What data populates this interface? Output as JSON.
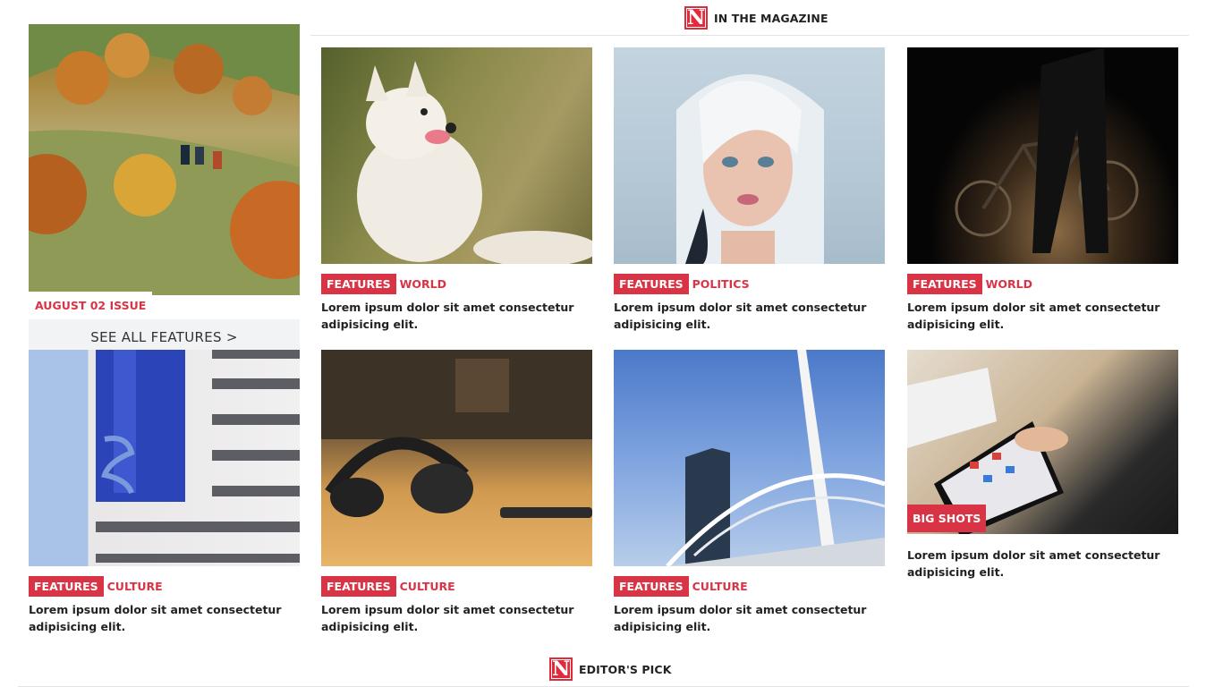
{
  "magazine_section": {
    "title": "IN THE MAGAZINE",
    "logo_letter": "N"
  },
  "editors_section": {
    "title": "EDITOR'S PICK",
    "logo_letter": "N"
  },
  "feature": {
    "issue_label": "AUGUST 02 ISSUE",
    "see_all_label": "SEE ALL FEATURES >"
  },
  "cards": [
    {
      "tag": "FEATURES",
      "category": "WORLD",
      "excerpt": "Lorem ipsum dolor sit amet consectetur adipisicing elit."
    },
    {
      "tag": "FEATURES",
      "category": "POLITICS",
      "excerpt": "Lorem ipsum dolor sit amet consectetur adipisicing elit."
    },
    {
      "tag": "FEATURES",
      "category": "WORLD",
      "excerpt": "Lorem ipsum dolor sit amet consectetur adipisicing elit."
    },
    {
      "tag": "FEATURES",
      "category": "CULTURE",
      "excerpt": "Lorem ipsum dolor sit amet consectetur adipisicing elit."
    },
    {
      "tag": "FEATURES",
      "category": "CULTURE",
      "excerpt": "Lorem ipsum dolor sit amet consectetur adipisicing elit."
    },
    {
      "tag": "FEATURES",
      "category": "CULTURE",
      "excerpt": "Lorem ipsum dolor sit amet consectetur adipisicing elit."
    },
    {
      "tag": "BIG SHOTS",
      "excerpt": "Lorem ipsum dolor sit amet consectetur adipisicing elit."
    }
  ],
  "colors": {
    "accent": "#d93445",
    "logo_red": "#e02b3c",
    "see_all_bg": "#f2f3f4"
  },
  "icons": {
    "section_logo": "n-logo-icon"
  }
}
